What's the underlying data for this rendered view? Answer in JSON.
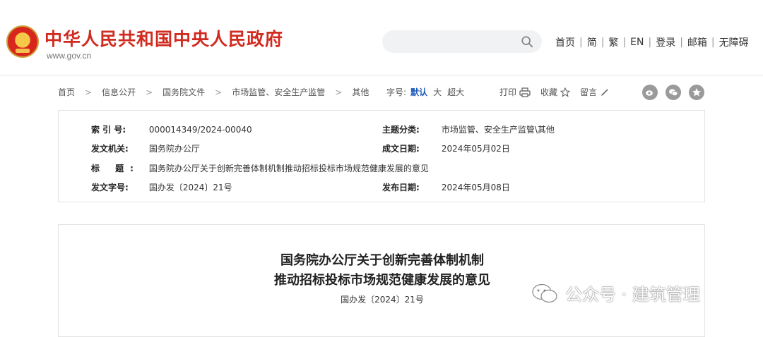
{
  "header": {
    "site_title": "中华人民共和国中央人民政府",
    "site_url": "www.gov.cn",
    "nav": [
      "首页",
      "简",
      "繁",
      "EN",
      "登录",
      "邮箱",
      "无障碍"
    ]
  },
  "breadcrumb": [
    "首页",
    "信息公开",
    "国务院文件",
    "市场监管、安全生产监管",
    "其他"
  ],
  "font_size": {
    "label": "字号:",
    "options": [
      "默认",
      "大",
      "超大"
    ],
    "active": "默认"
  },
  "tools": {
    "print": "打印",
    "favorite": "收藏",
    "comment": "留言"
  },
  "info": {
    "index_label": "索 引 号:",
    "index_value": "000014349/2024-00040",
    "topic_label": "主题分类:",
    "topic_value": "市场监管、安全生产监管\\其他",
    "issuer_label": "发文机关:",
    "issuer_value": "国务院办公厅",
    "created_label": "成文日期:",
    "created_value": "2024年05月02日",
    "title_label": "标 题:",
    "title_value": "国务院办公厅关于创新完善体制机制推动招标投标市场规范健康发展的意见",
    "doc_no_label": "发文字号:",
    "doc_no_value": "国办发〔2024〕21号",
    "published_label": "发布日期:",
    "published_value": "2024年05月08日"
  },
  "document": {
    "title_line1": "国务院办公厅关于创新完善体制机制",
    "title_line2": "推动招标投标市场规范健康发展的意见",
    "doc_number": "国办发〔2024〕21号"
  },
  "watermark": "公众号 · 建筑管理",
  "colors": {
    "brand_red": "#d12a1f",
    "active_blue": "#1e5bb8"
  }
}
